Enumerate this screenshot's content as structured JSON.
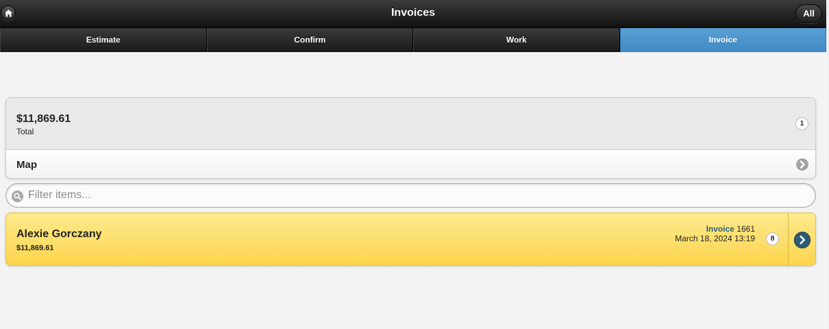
{
  "header": {
    "title": "Invoices",
    "home_icon": "home-icon",
    "right_button_label": "All"
  },
  "tabs": [
    {
      "label": "Estimate",
      "active": false
    },
    {
      "label": "Confirm",
      "active": false
    },
    {
      "label": "Work",
      "active": false
    },
    {
      "label": "Invoice",
      "active": true
    }
  ],
  "summary": {
    "total_amount": "$11,869.61",
    "total_label": "Total",
    "count": "1",
    "map_label": "Map",
    "map_icon": "arrow-right-icon"
  },
  "filter": {
    "placeholder": "Filter items...",
    "icon": "search-icon"
  },
  "items": [
    {
      "name": "Alexie Gorczany",
      "amount": "$11,869.61",
      "doc_type": "Invoice",
      "doc_number": "1661",
      "datetime": "March 18, 2024 13:19",
      "count": "8",
      "icon": "arrow-right-icon"
    }
  ],
  "colors": {
    "active_tab": "#4a90c8",
    "item_bg": "#fde27a",
    "invoice_label": "#2a5f7a"
  }
}
